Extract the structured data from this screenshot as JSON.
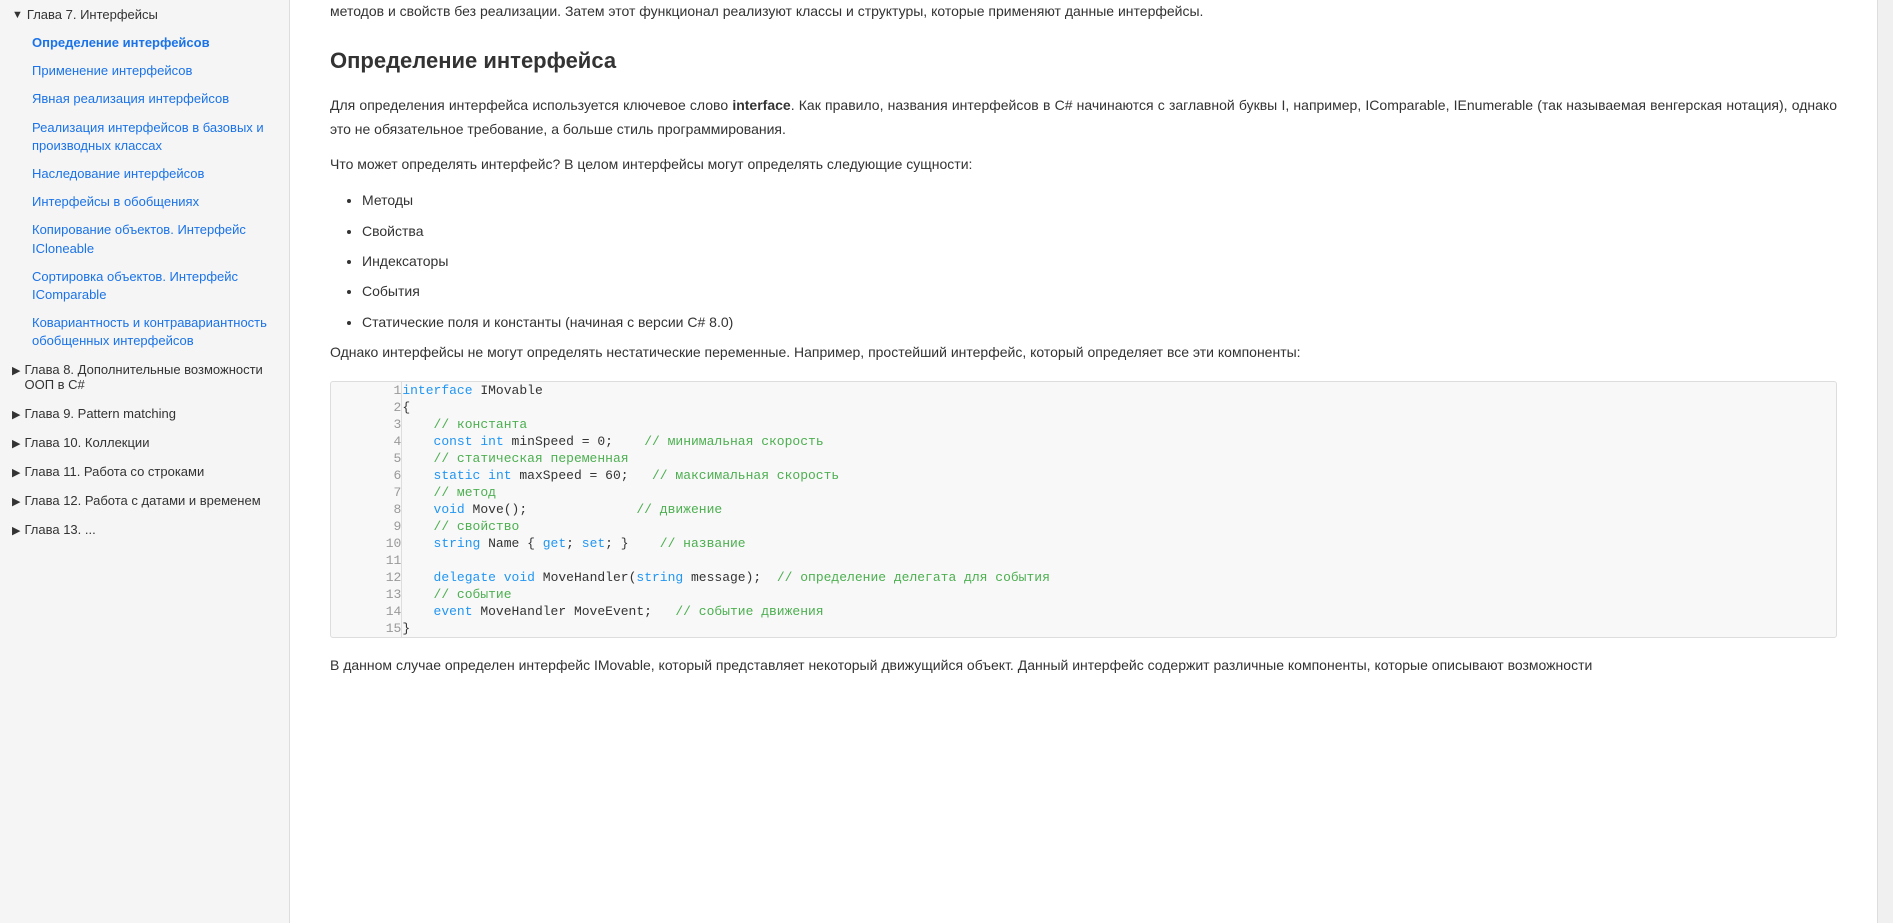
{
  "sidebar": {
    "items": [
      {
        "id": "chapter7",
        "type": "chapter-expanded",
        "label": "Глава 7. Интерфейсы",
        "arrow": "▼"
      },
      {
        "id": "def-interface",
        "type": "subitem-active",
        "label": "Определение интерфейсов"
      },
      {
        "id": "apply-interface",
        "type": "subitem",
        "label": "Применение интерфейсов"
      },
      {
        "id": "explicit-impl",
        "type": "subitem",
        "label": "Явная реализация интерфейсов"
      },
      {
        "id": "base-derived",
        "type": "subitem",
        "label": "Реализация интерфейсов в базовых и производных классах"
      },
      {
        "id": "inherit-iface",
        "type": "subitem",
        "label": "Наследование интерфейсов"
      },
      {
        "id": "iface-generics",
        "type": "subitem",
        "label": "Интерфейсы в обобщениях"
      },
      {
        "id": "copy-icloneable",
        "type": "subitem",
        "label": "Копирование объектов. Интерфейс ICloneable"
      },
      {
        "id": "sort-icomparable",
        "type": "subitem",
        "label": "Сортировка объектов. Интерфейс IComparable"
      },
      {
        "id": "covariant",
        "type": "subitem",
        "label": "Ковариантность и контравариантность обобщенных интерфейсов"
      },
      {
        "id": "chapter8",
        "type": "chapter",
        "label": "Глава 8. Дополнительные возможности ООП в C#",
        "arrow": "▶"
      },
      {
        "id": "chapter9",
        "type": "chapter",
        "label": "Глава 9. Pattern matching",
        "arrow": "▶"
      },
      {
        "id": "chapter10",
        "type": "chapter",
        "label": "Глава 10. Коллекции",
        "arrow": "▶"
      },
      {
        "id": "chapter11",
        "type": "chapter",
        "label": "Глава 11. Работа со строками",
        "arrow": "▶"
      },
      {
        "id": "chapter12",
        "type": "chapter",
        "label": "Глава 12. Работа с датами и временем",
        "arrow": "▶"
      },
      {
        "id": "chapter13",
        "type": "chapter",
        "label": "Глава 13. ...",
        "arrow": "▶"
      }
    ]
  },
  "content": {
    "top_text": "методов и свойств без реализации. Затем этот функционал реализуют классы и структуры, которые применяют данные интерфейсы.",
    "page_title": "Определение интерфейса",
    "para1": "Для определения интерфейса используется ключевое слово interface. Как правило, названия интерфейсов в C# начинаются с заглавной буквы I, например, IComparable, IEnumerable (так называемая венгерская нотация), однако это не обязательное требование, а больше стиль программирования.",
    "para1_bold": "interface",
    "para2": "Что может определять интерфейс? В целом интерфейсы могут определять следующие сущности:",
    "bullets": [
      "Методы",
      "Свойства",
      "Индексаторы",
      "События",
      "Статические поля и константы (начиная с версии C# 8.0)"
    ],
    "para3": "Однако интерфейсы не могут определять нестатические переменные. Например, простейший интерфейс, который определяет все эти компоненты:",
    "para4": "В данном случае определен интерфейс IMovable, который представляет некоторый движущийся объект. Данный интерфейс содержит различные компоненты, которые описывают возможности",
    "code": {
      "lines": [
        {
          "num": 1,
          "parts": [
            {
              "t": "kw",
              "v": "interface"
            },
            {
              "t": "fn",
              "v": " IMovable"
            }
          ]
        },
        {
          "num": 2,
          "parts": [
            {
              "t": "fn",
              "v": "{"
            }
          ]
        },
        {
          "num": 3,
          "parts": [
            {
              "t": "cm",
              "v": "    // константа"
            }
          ]
        },
        {
          "num": 4,
          "parts": [
            {
              "t": "kw",
              "v": "    const"
            },
            {
              "t": "fn",
              "v": " "
            },
            {
              "t": "kw",
              "v": "int"
            },
            {
              "t": "fn",
              "v": " minSpeed = 0;    "
            },
            {
              "t": "cm",
              "v": "// минимальная скорость"
            }
          ]
        },
        {
          "num": 5,
          "parts": [
            {
              "t": "cm",
              "v": "    // статическая переменная"
            }
          ]
        },
        {
          "num": 6,
          "parts": [
            {
              "t": "kw",
              "v": "    static"
            },
            {
              "t": "fn",
              "v": " "
            },
            {
              "t": "kw",
              "v": "int"
            },
            {
              "t": "fn",
              "v": " maxSpeed = 60;   "
            },
            {
              "t": "cm",
              "v": "// максимальная скорость"
            }
          ]
        },
        {
          "num": 7,
          "parts": [
            {
              "t": "cm",
              "v": "    // метод"
            }
          ]
        },
        {
          "num": 8,
          "parts": [
            {
              "t": "kw",
              "v": "    void"
            },
            {
              "t": "fn",
              "v": " Move();              "
            },
            {
              "t": "cm",
              "v": "// движение"
            }
          ]
        },
        {
          "num": 9,
          "parts": [
            {
              "t": "cm",
              "v": "    // свойство"
            }
          ]
        },
        {
          "num": 10,
          "parts": [
            {
              "t": "kw",
              "v": "    string"
            },
            {
              "t": "fn",
              "v": " Name { "
            },
            {
              "t": "kw",
              "v": "get"
            },
            {
              "t": "fn",
              "v": "; "
            },
            {
              "t": "kw",
              "v": "set"
            },
            {
              "t": "fn",
              "v": "; }    "
            },
            {
              "t": "cm",
              "v": "// название"
            }
          ]
        },
        {
          "num": 11,
          "parts": [
            {
              "t": "fn",
              "v": ""
            }
          ]
        },
        {
          "num": 12,
          "parts": [
            {
              "t": "kw",
              "v": "    delegate"
            },
            {
              "t": "fn",
              "v": " "
            },
            {
              "t": "kw",
              "v": "void"
            },
            {
              "t": "fn",
              "v": " MoveHandler("
            },
            {
              "t": "kw",
              "v": "string"
            },
            {
              "t": "fn",
              "v": " message);  "
            },
            {
              "t": "cm",
              "v": "// определение делегата для события"
            }
          ]
        },
        {
          "num": 13,
          "parts": [
            {
              "t": "cm",
              "v": "    // событие"
            }
          ]
        },
        {
          "num": 14,
          "parts": [
            {
              "t": "kw",
              "v": "    event"
            },
            {
              "t": "fn",
              "v": " MoveHandler MoveEvent;   "
            },
            {
              "t": "cm",
              "v": "// событие движения"
            }
          ]
        },
        {
          "num": 15,
          "parts": [
            {
              "t": "fn",
              "v": "}"
            }
          ]
        }
      ]
    }
  }
}
